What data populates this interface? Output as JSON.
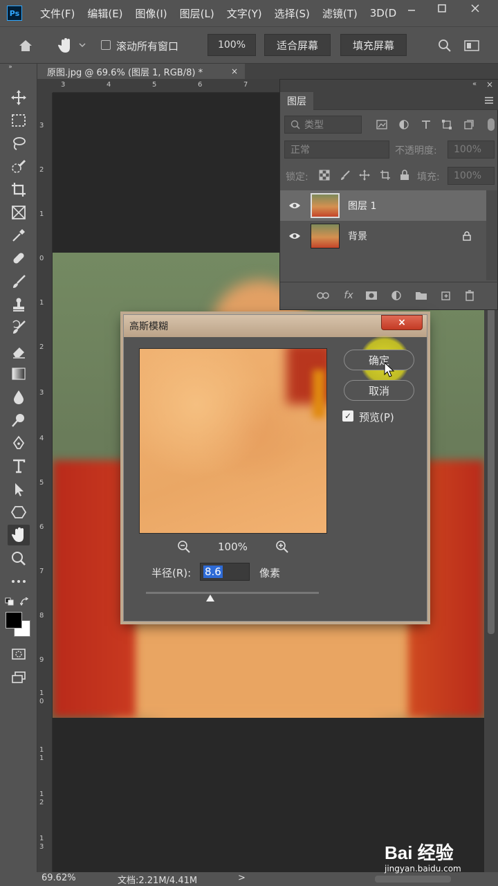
{
  "app": {
    "logo": "Ps",
    "menu": [
      "文件(F)",
      "编辑(E)",
      "图像(I)",
      "图层(L)",
      "文字(Y)",
      "选择(S)",
      "滤镜(T)",
      "3D(D"
    ]
  },
  "options": {
    "scroll_all_label": "滚动所有窗口",
    "zoom_value": "100%",
    "fit_screen": "适合屏幕",
    "fill_screen": "填充屏幕"
  },
  "document": {
    "tab_title": "原图.jpg @ 69.6% (图层 1, RGB/8) *",
    "tab_close": "×"
  },
  "ruler": {
    "top": [
      "3",
      "4",
      "5",
      "6",
      "7"
    ],
    "left": [
      "3",
      "2",
      "1",
      "0",
      "1",
      "2",
      "3",
      "4",
      "5",
      "6",
      "7",
      "8",
      "9",
      "1\n0",
      "1\n1",
      "1\n2",
      "1\n3"
    ]
  },
  "layers_panel": {
    "tab": "图层",
    "filter_kind": "类型",
    "blend_mode": "正常",
    "opacity_label": "不透明度:",
    "opacity_value": "100%",
    "lock_label": "锁定:",
    "fill_label": "填充:",
    "fill_value": "100%",
    "layers": [
      {
        "name": "图层 1",
        "selected": true,
        "locked": false
      },
      {
        "name": "背景",
        "selected": false,
        "locked": true
      }
    ]
  },
  "dialog": {
    "title": "高斯模糊",
    "close": "×",
    "ok": "确定",
    "cancel": "取消",
    "preview_label": "预览(P)",
    "preview_checked": true,
    "zoom_level": "100%",
    "radius_label": "半径(R):",
    "radius_value": "8.6",
    "radius_unit": "像素"
  },
  "status": {
    "zoom": "69.62%",
    "doc_size": "文档:2.21M/4.41M",
    "arrow": ">"
  },
  "watermark": {
    "logo": "Bai 经验",
    "url": "jingyan.baidu.com"
  },
  "colors": {
    "ui_bg": "#535353",
    "canvas_bg": "#282828",
    "dialog_title": "#c9b294",
    "highlight": "#e1dc28",
    "selection": "#2e6bd6"
  }
}
